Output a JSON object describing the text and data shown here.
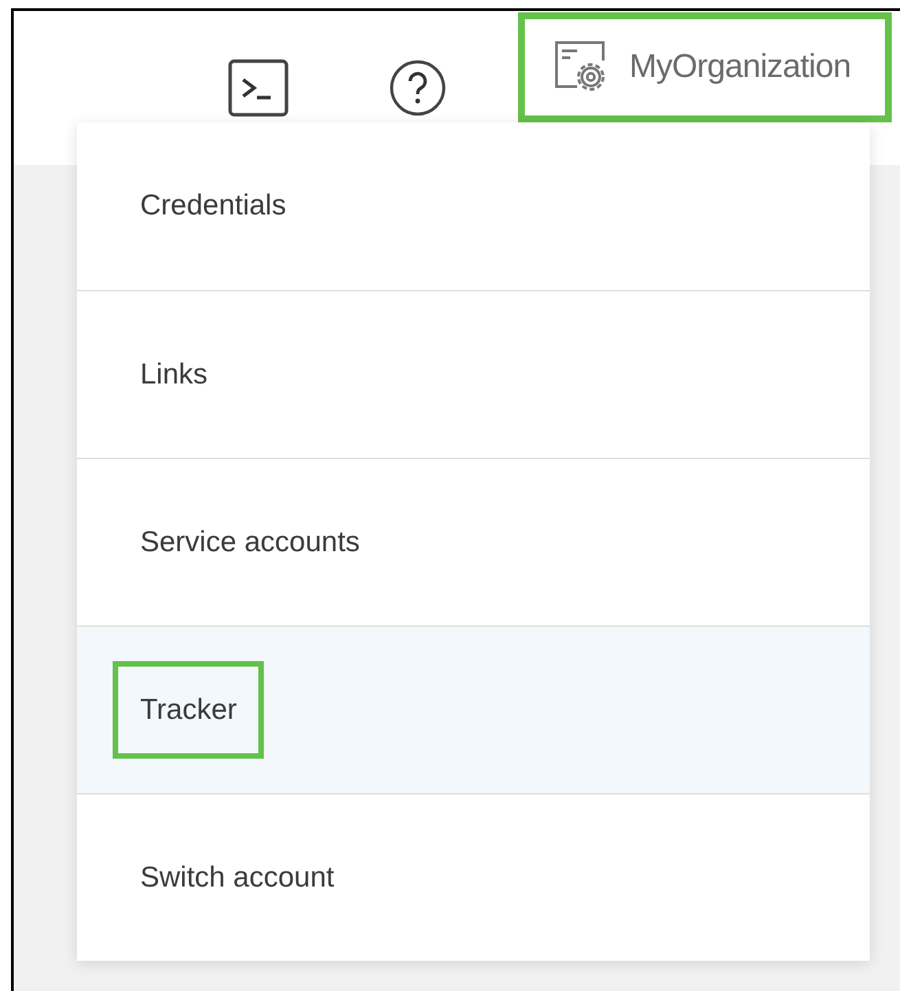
{
  "header": {
    "organization": {
      "label": "MyOrganization",
      "outlined": true
    }
  },
  "menu": {
    "items": [
      {
        "label": "Credentials",
        "selected": false,
        "outlined": false
      },
      {
        "label": "Links",
        "selected": false,
        "outlined": false
      },
      {
        "label": "Service accounts",
        "selected": false,
        "outlined": false
      },
      {
        "label": "Tracker",
        "selected": true,
        "outlined": true
      },
      {
        "label": "Switch account",
        "selected": false,
        "outlined": false
      }
    ]
  }
}
